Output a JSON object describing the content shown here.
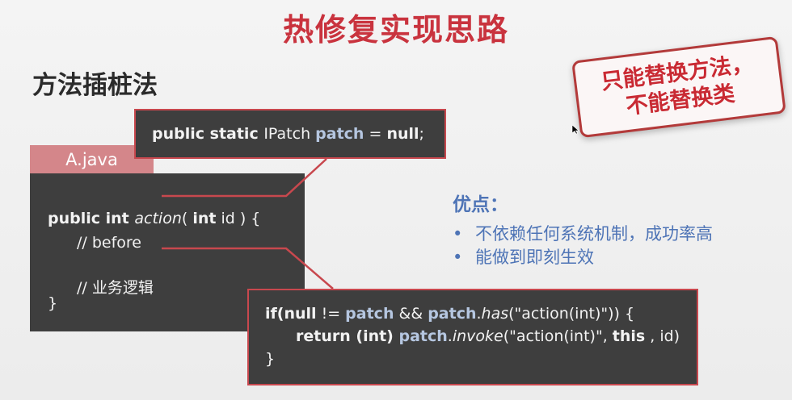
{
  "slide": {
    "title": "热修复实现思路",
    "subtitle": "方法插桩法"
  },
  "stamp": {
    "line1": "只能替换方法，",
    "line2": "不能替换类"
  },
  "file_tab": "A.java",
  "code_a": {
    "l1_kw": "public int ",
    "l1_fn": "action",
    "l1_p1": "( ",
    "l1_kw2": "int",
    "l1_rest": " id ) {",
    "l2": "// before",
    "l3": "// 业务逻辑",
    "l4": "}"
  },
  "field_box": {
    "kw": "public static ",
    "type": "IPatch ",
    "name": "patch",
    "eq": " = ",
    "null": "null",
    "end": ";"
  },
  "patch_box": {
    "l1": [
      "if(",
      "null",
      " != ",
      "patch",
      " && ",
      "patch",
      ".",
      "has",
      "(\"action(int)\")) {"
    ],
    "l2": [
      "return",
      " (int) ",
      "patch",
      ".",
      "invoke",
      "(\"action(int)\", ",
      "this",
      " , id)"
    ],
    "l3": "}"
  },
  "pros": {
    "title": "优点：",
    "items": [
      "不依赖任何系统机制，成功率高",
      "能做到即刻生效"
    ],
    "bullet_char": "•"
  },
  "colors": {
    "title": "#c9333e",
    "accent_border": "#c8484e",
    "code_bg": "#3e3e3e",
    "tab_bg": "#d4868a",
    "pros_blue": "#4e74b6",
    "patch_var": "#b5c6e0"
  },
  "icons": [
    "mouse-cursor-icon"
  ]
}
